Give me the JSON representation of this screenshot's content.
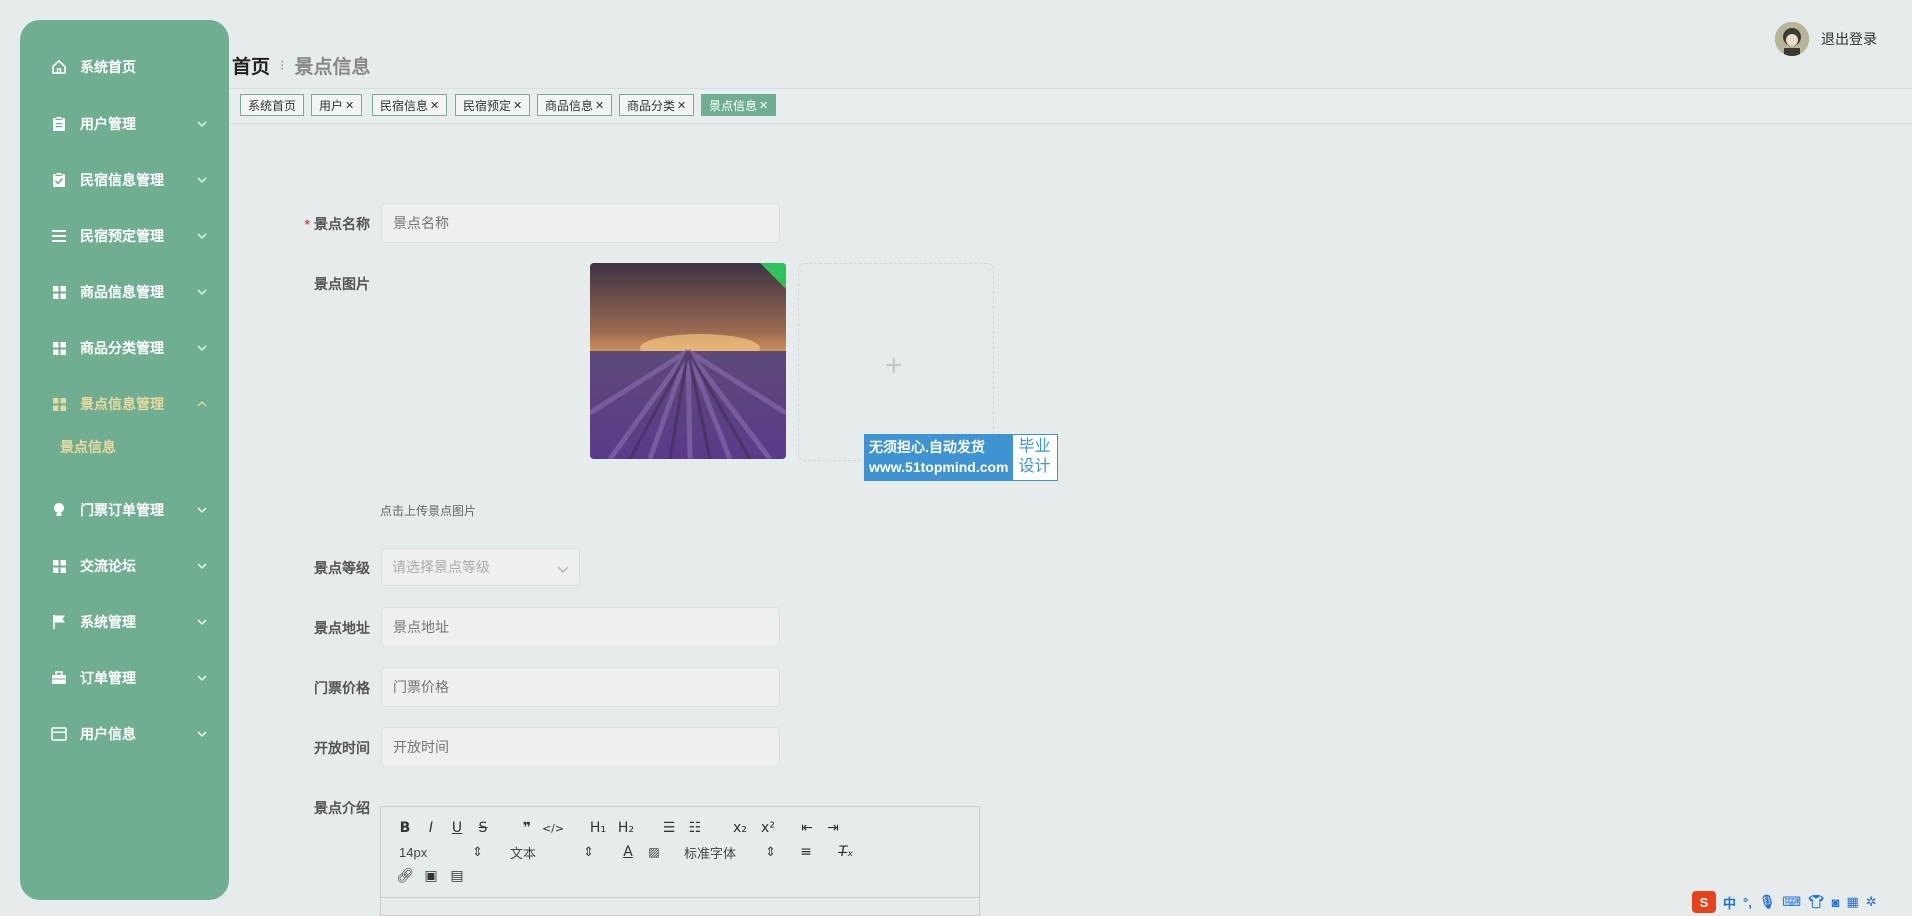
{
  "sidebar": {
    "items": [
      {
        "label": "系统首页",
        "icon": "home-icon"
      },
      {
        "label": "用户管理",
        "icon": "clipboard-icon"
      },
      {
        "label": "民宿信息管理",
        "icon": "clipboard-check-icon"
      },
      {
        "label": "民宿预定管理",
        "icon": "list-icon"
      },
      {
        "label": "商品信息管理",
        "icon": "grid-icon"
      },
      {
        "label": "商品分类管理",
        "icon": "grid-icon"
      },
      {
        "label": "景点信息管理",
        "icon": "grid-icon"
      },
      {
        "label": "门票订单管理",
        "icon": "lightbulb-icon"
      },
      {
        "label": "交流论坛",
        "icon": "grid-icon"
      },
      {
        "label": "系统管理",
        "icon": "flag-icon"
      },
      {
        "label": "订单管理",
        "icon": "briefcase-icon"
      },
      {
        "label": "用户信息",
        "icon": "card-icon"
      }
    ],
    "submenu": {
      "label": "景点信息"
    }
  },
  "header": {
    "breadcrumb_home": "首页",
    "breadcrumb_current": "景点信息",
    "logout": "退出登录"
  },
  "tabs": [
    {
      "label": "系统首页",
      "closable": false
    },
    {
      "label": "用户",
      "closable": true
    },
    {
      "label": "民宿信息",
      "closable": true
    },
    {
      "label": "民宿预定",
      "closable": true
    },
    {
      "label": "商品信息",
      "closable": true
    },
    {
      "label": "商品分类",
      "closable": true
    },
    {
      "label": "景点信息",
      "closable": true,
      "active": true
    }
  ],
  "form": {
    "name": {
      "label": "景点名称",
      "placeholder": "景点名称"
    },
    "image": {
      "label": "景点图片",
      "hint": "点击上传景点图片"
    },
    "level": {
      "label": "景点等级",
      "placeholder": "请选择景点等级"
    },
    "address": {
      "label": "景点地址",
      "placeholder": "景点地址"
    },
    "price": {
      "label": "门票价格",
      "placeholder": "门票价格"
    },
    "open_time": {
      "label": "开放时间",
      "placeholder": "开放时间"
    },
    "intro": {
      "label": "景点介绍"
    }
  },
  "editor": {
    "size": "14px",
    "header": "文本",
    "font": "标准字体"
  },
  "watermark": {
    "line1": "无须担心.自动发货",
    "line2": "www.51topmind.com",
    "right1": "毕业",
    "right2": "设计"
  },
  "ime": {
    "lang": "中"
  },
  "colors": {
    "sidebar": "#6fae91",
    "active_tab": "#6fae91",
    "required": "#e24b4b"
  }
}
